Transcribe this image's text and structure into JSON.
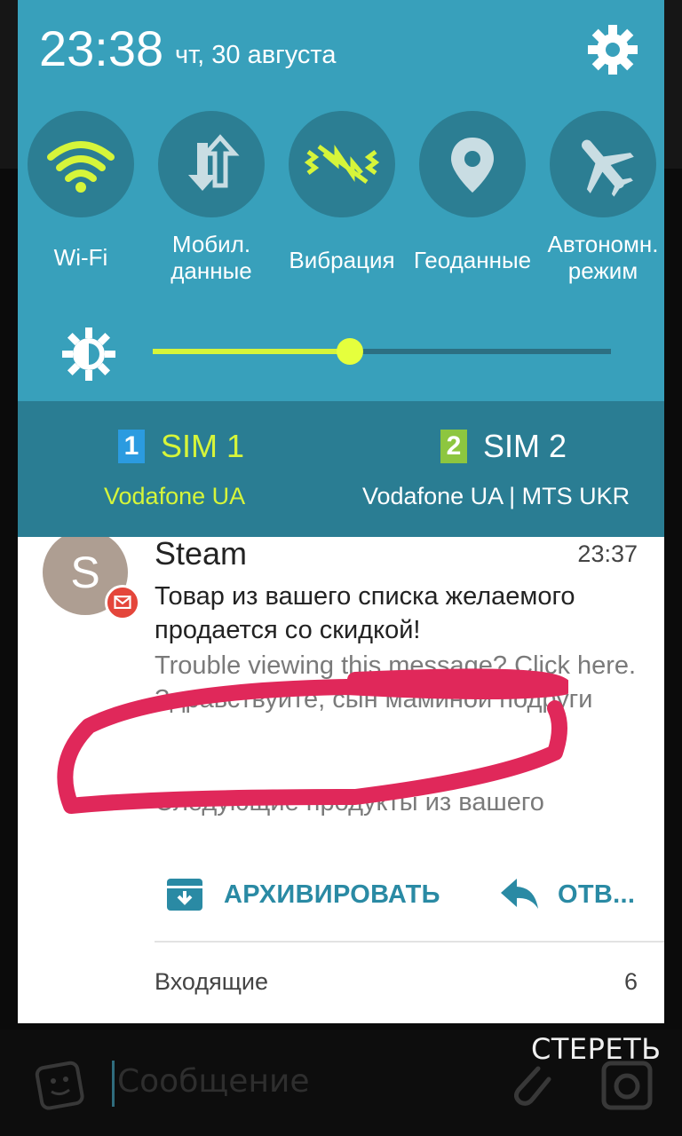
{
  "status": {
    "time": "23:38",
    "date": "чт, 30 августа"
  },
  "quick_settings": [
    {
      "label_line1": "Wi-Fi",
      "label_line2": "",
      "icon": "wifi-icon",
      "active": true
    },
    {
      "label_line1": "Мобил.",
      "label_line2": "данные",
      "icon": "mobile-data-icon",
      "active": false
    },
    {
      "label_line1": "Вибрация",
      "label_line2": "",
      "icon": "vibration-icon",
      "active": true
    },
    {
      "label_line1": "Геоданные",
      "label_line2": "",
      "icon": "location-icon",
      "active": false
    },
    {
      "label_line1": "Автономн.",
      "label_line2": "режим",
      "icon": "airplane-icon",
      "active": false
    }
  ],
  "brightness": {
    "level": 0.43
  },
  "sims": [
    {
      "badge": "1",
      "name": "SIM 1",
      "operator": "Vodafone UA",
      "color": "#d6f53a",
      "badge_color": "#2b9be0"
    },
    {
      "badge": "2",
      "name": "SIM 2",
      "operator": "Vodafone UA | MTS UKR",
      "color": "#ffffff",
      "badge_color": "#8dc63f"
    }
  ],
  "notification": {
    "avatar_letter": "S",
    "sender": "Steam",
    "time": "23:37",
    "subject": "Товар из вашего списка желаемого продается со скидкой!",
    "preview_line1": "Trouble viewing this message? Click here.",
    "preview_line2": "Здравствуйте, сын маминой подруги",
    "preview_line3": "Следующие продукты из вашего",
    "actions": {
      "archive": "АРХИВИРОВАТЬ",
      "reply": "ОТВ..."
    },
    "folder": "Входящие",
    "count": "6"
  },
  "background": {
    "clear_label": "СТЕРЕТЬ",
    "message_placeholder": "Сообщение"
  },
  "colors": {
    "shade": "#38a0bb",
    "qs_circle": "#2c7e93",
    "accent_yellow": "#d6f53a",
    "action_teal": "#2a8aa4",
    "scribble": "#e0285a"
  }
}
